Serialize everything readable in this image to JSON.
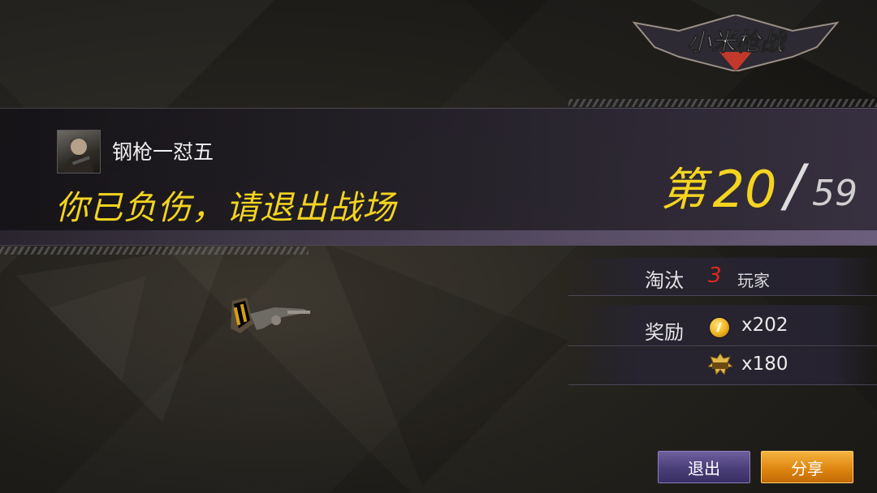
{
  "game_logo_text": "小米枪战",
  "player": {
    "name": "钢枪一怼五"
  },
  "status_message": "你已负伤，请退出战场",
  "rank": {
    "prefix": "第",
    "position": "20",
    "separator": "/",
    "total": "59"
  },
  "eliminations": {
    "label": "淘汰",
    "count": "3",
    "unit": "玩家"
  },
  "rewards": {
    "label": "奖励",
    "items": [
      {
        "icon": "gold-coin-icon",
        "amount": "x202"
      },
      {
        "icon": "experience-badge-icon",
        "amount": "x180"
      }
    ]
  },
  "buttons": {
    "exit": "退出",
    "share": "分享"
  },
  "colors": {
    "accent_yellow": "#f3d41f",
    "kill_red": "#e3261c",
    "exit_purple": "#4a3e78",
    "share_orange": "#df8710"
  }
}
